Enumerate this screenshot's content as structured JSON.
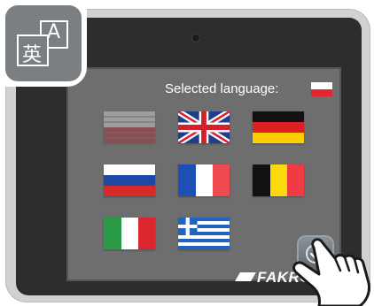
{
  "header": {
    "selected_language_label": "Selected language:"
  },
  "brand": {
    "name": "FAKRO"
  },
  "badge": {
    "glyph_cjk": "英",
    "glyph_latin": "A"
  },
  "icons": {
    "badge": "translate-icon",
    "ok": "check-circle-icon",
    "hand": "pointing-hand-icon"
  },
  "selected_language": "polish",
  "languages": [
    {
      "id": "polish",
      "state": "selected-dimmed"
    },
    {
      "id": "english-uk"
    },
    {
      "id": "german"
    },
    {
      "id": "russian"
    },
    {
      "id": "french"
    },
    {
      "id": "belgian"
    },
    {
      "id": "italian"
    },
    {
      "id": "greek"
    }
  ],
  "colors": {
    "screen": "#6e6e6e",
    "bezel": "#2d2d2e",
    "frame": "#cfd1d3",
    "badge": "#7c7f82"
  }
}
